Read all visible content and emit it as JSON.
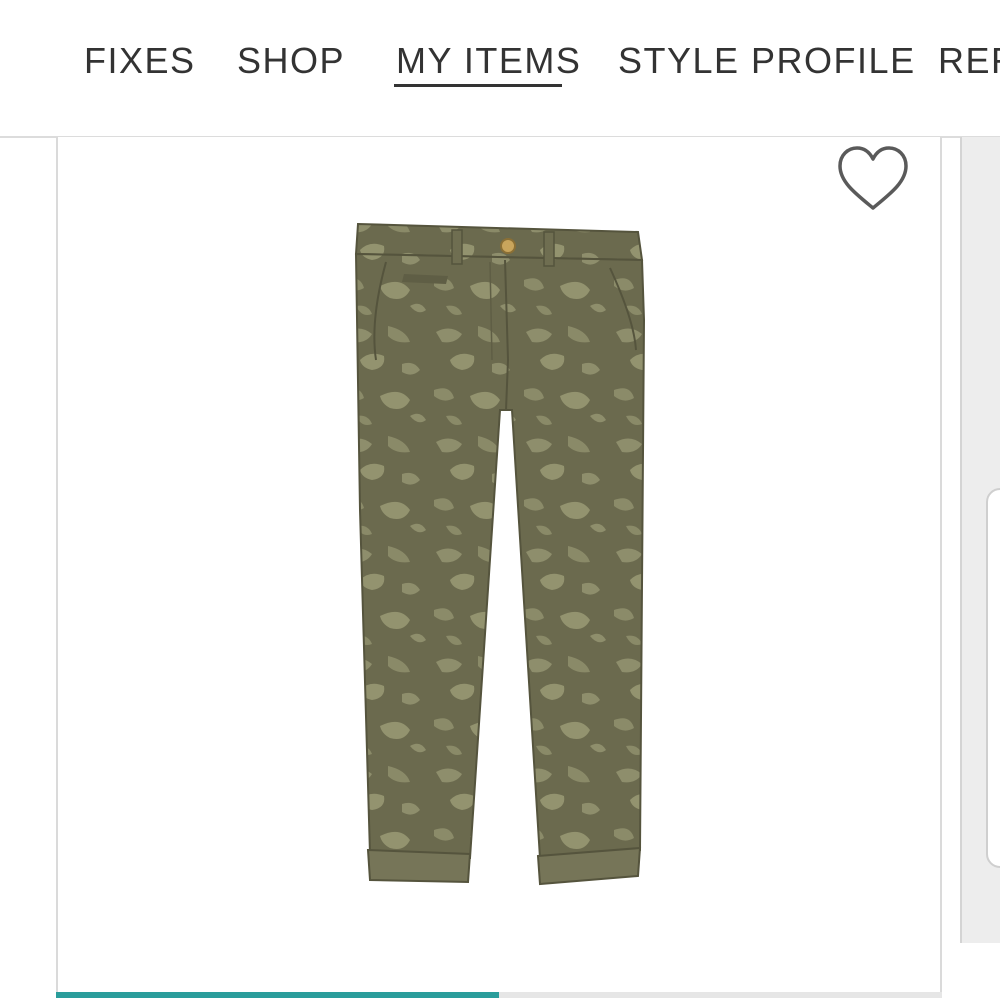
{
  "nav": {
    "items": [
      {
        "label": "FIXES"
      },
      {
        "label": "SHOP"
      },
      {
        "label": "MY ITEMS",
        "active": true
      },
      {
        "label": "STYLE PROFILE"
      },
      {
        "label": "REF"
      }
    ]
  },
  "product": {
    "image_icon": "olive-camo-pants-image",
    "favorite_icon": "heart-outline-icon",
    "colors": {
      "fabric": "#6b6a4e",
      "camo": "#8e8e6c",
      "cuff": "#767558"
    }
  },
  "carousel": {
    "progress": 0.5,
    "accent": "#2a9d9b"
  }
}
